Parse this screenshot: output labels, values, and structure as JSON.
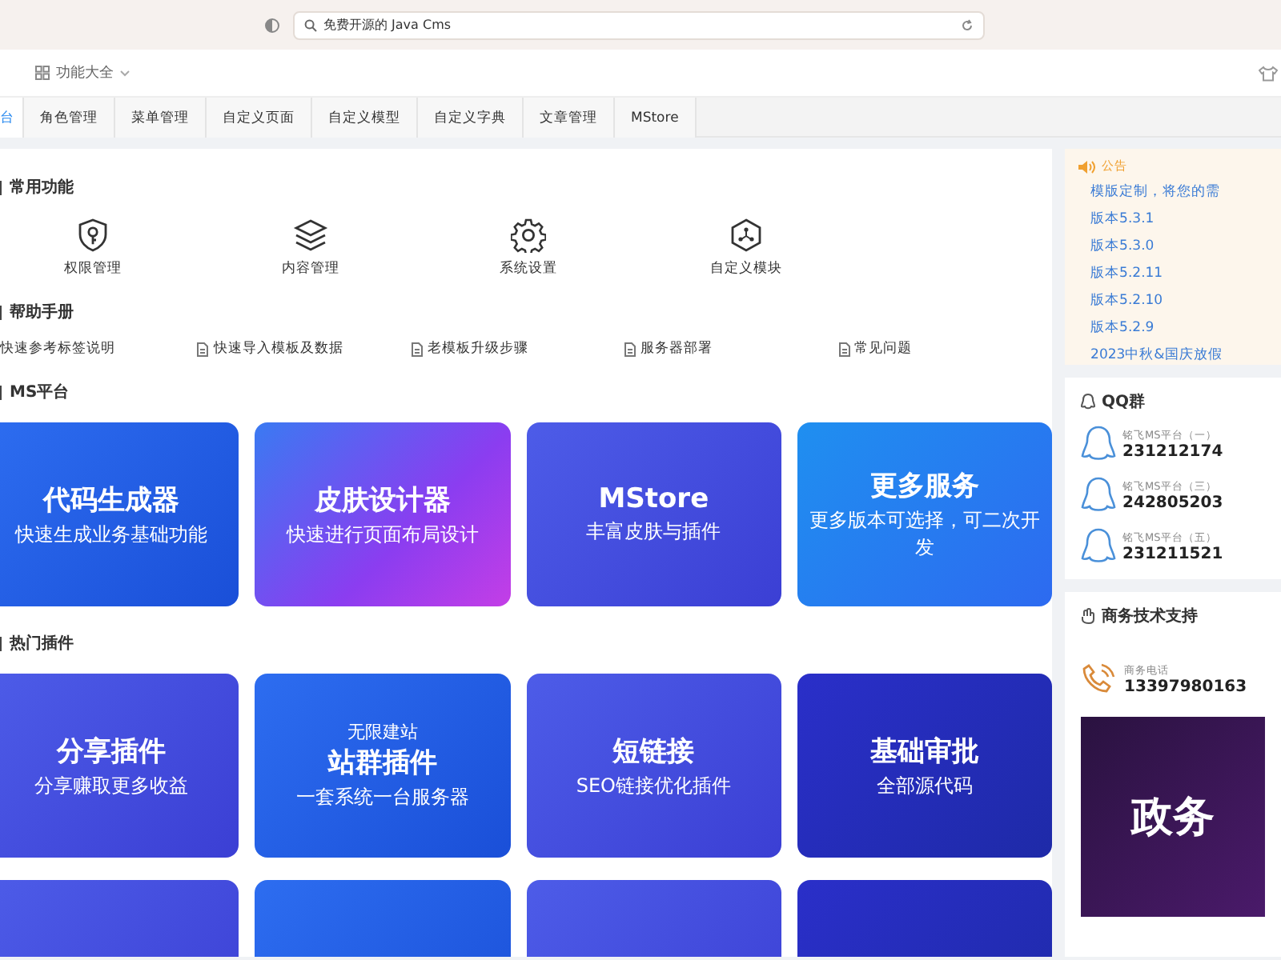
{
  "browser": {
    "address": "免费开源的 Java Cms"
  },
  "header": {
    "menu_label": "功能大全"
  },
  "tabs": [
    {
      "label": "台",
      "selected": true
    },
    {
      "label": "角色管理",
      "selected": false
    },
    {
      "label": "菜单管理",
      "selected": false
    },
    {
      "label": "自定义页面",
      "selected": false
    },
    {
      "label": "自定义模型",
      "selected": false
    },
    {
      "label": "自定义字典",
      "selected": false
    },
    {
      "label": "文章管理",
      "selected": false
    },
    {
      "label": "MStore",
      "selected": false
    }
  ],
  "sections": [
    {
      "kind": "shortcuts",
      "title": "常用功能",
      "items": [
        {
          "label": "权限管理"
        },
        {
          "label": "内容管理"
        },
        {
          "label": "系统设置"
        },
        {
          "label": "自定义模块"
        }
      ]
    },
    {
      "kind": "links",
      "title": "帮助手册",
      "items": [
        "快速参考标签说明",
        "快速导入模板及数据",
        "老模板升级步骤",
        "服务器部署",
        "常见问题"
      ]
    },
    {
      "kind": "cards",
      "title": "MS平台",
      "items": [
        {
          "title": "代码生成器",
          "subtitle": "快速生成业务基础功能"
        },
        {
          "title": "皮肤设计器",
          "subtitle": "快速进行页面布局设计"
        },
        {
          "title": "MStore",
          "subtitle": "丰富皮肤与插件"
        },
        {
          "title": "更多服务",
          "subtitle": "更多版本可选择，可二次开发"
        }
      ]
    },
    {
      "kind": "cards",
      "title": "热门插件",
      "items": [
        {
          "title": "分享插件",
          "subtitle": "分享赚取更多收益"
        },
        {
          "eyebrow": "无限建站",
          "title": "站群插件",
          "subtitle": "一套系统一台服务器"
        },
        {
          "title": "短链接",
          "subtitle": "SEO链接优化插件"
        },
        {
          "title": "基础审批",
          "subtitle": "全部源代码"
        }
      ]
    }
  ],
  "notice": {
    "title": "公告",
    "items": [
      "模版定制，将您的需",
      "版本5.3.1",
      "版本5.3.0",
      "版本5.2.11",
      "版本5.2.10",
      "版本5.2.9",
      "2023中秋&国庆放假"
    ]
  },
  "qq": {
    "title": "QQ群",
    "groups": [
      {
        "name": "铭飞MS平台（一）",
        "number": "231212174"
      },
      {
        "name": "铭飞MS平台（三）",
        "number": "242805203"
      },
      {
        "name": "铭飞MS平台（五）",
        "number": "231211521"
      }
    ]
  },
  "support": {
    "title": "商务技术支持",
    "phone_label": "商务电话",
    "phone": "13397980163",
    "banner_title": "政务"
  }
}
